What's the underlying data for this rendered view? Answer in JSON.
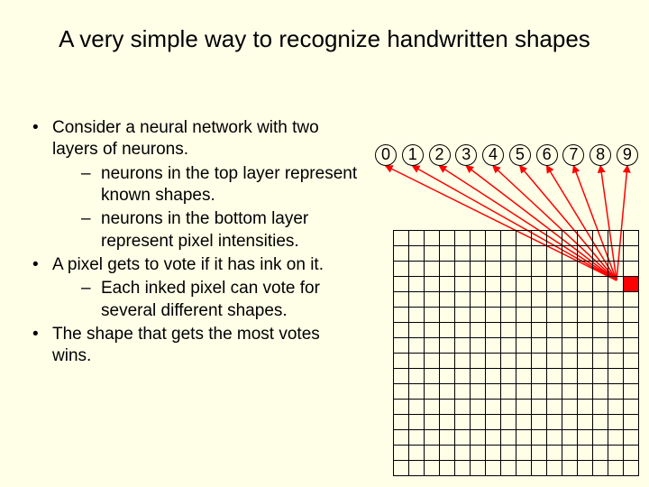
{
  "title": "A very simple way to recognize handwritten shapes",
  "bullets": {
    "b0": "Consider a neural network with two layers of neurons.",
    "b0s0": "neurons in the top layer represent known shapes.",
    "b0s1": " neurons in the bottom layer represent pixel intensities.",
    "b1": "A pixel gets to vote if it has ink on it.",
    "b1s0": "Each inked pixel can vote for several different shapes.",
    "b2": "The shape that gets the most votes wins."
  },
  "output_neurons": [
    "0",
    "1",
    "2",
    "3",
    "4",
    "5",
    "6",
    "7",
    "8",
    "9"
  ],
  "grid": {
    "rows": 16,
    "cols": 16,
    "ink_cells": [
      [
        3,
        15
      ]
    ]
  },
  "arrows": {
    "color": "#ff0000",
    "targets": [
      0,
      1,
      2,
      3,
      4,
      5,
      6,
      7,
      8,
      9
    ]
  }
}
